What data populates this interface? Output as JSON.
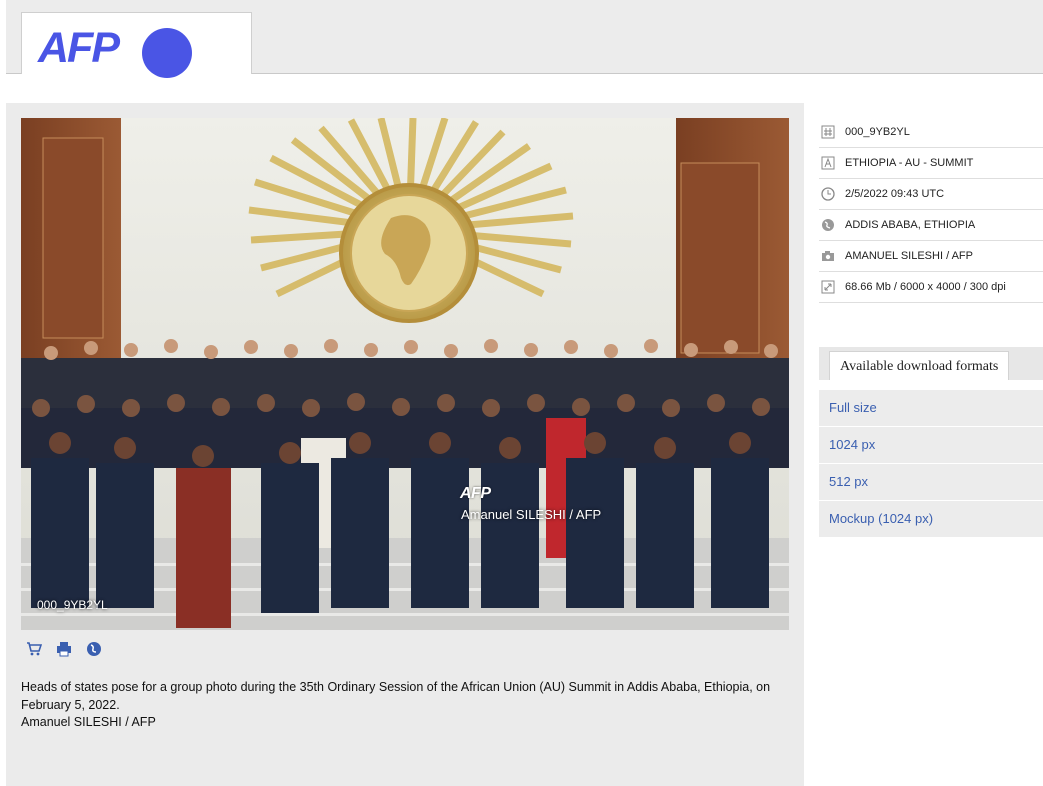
{
  "header": {
    "logo_text": "AFP",
    "brand_color": "#4a55e5"
  },
  "photo": {
    "watermark_logo": "AFP",
    "watermark_credit": "Amanuel SILESHI / AFP",
    "watermark_id": "000_9YB2YL"
  },
  "actions": [
    {
      "icon": "cart-icon"
    },
    {
      "icon": "print-icon"
    },
    {
      "icon": "globe-icon"
    }
  ],
  "caption": {
    "text": "Heads of states pose for a group photo during the 35th Ordinary Session of the African Union (AU) Summit in Addis Ababa, Ethiopia, on February 5, 2022.",
    "credit": "Amanuel SILESHI / AFP"
  },
  "metadata": [
    {
      "icon": "hash-icon",
      "value": "000_9YB2YL"
    },
    {
      "icon": "title-icon",
      "value": "ETHIOPIA - AU - SUMMIT"
    },
    {
      "icon": "clock-icon",
      "value": "2/5/2022 09:43 UTC"
    },
    {
      "icon": "location-globe-icon",
      "value": "ADDIS ABABA, ETHIOPIA"
    },
    {
      "icon": "camera-icon",
      "value": "AMANUEL SILESHI / AFP"
    },
    {
      "icon": "resize-icon",
      "value": "68.66 Mb / 6000 x 4000 / 300 dpi"
    }
  ],
  "downloads": {
    "title": "Available download formats",
    "items": [
      "Full size",
      "1024 px",
      "512 px",
      "Mockup (1024 px)"
    ]
  }
}
